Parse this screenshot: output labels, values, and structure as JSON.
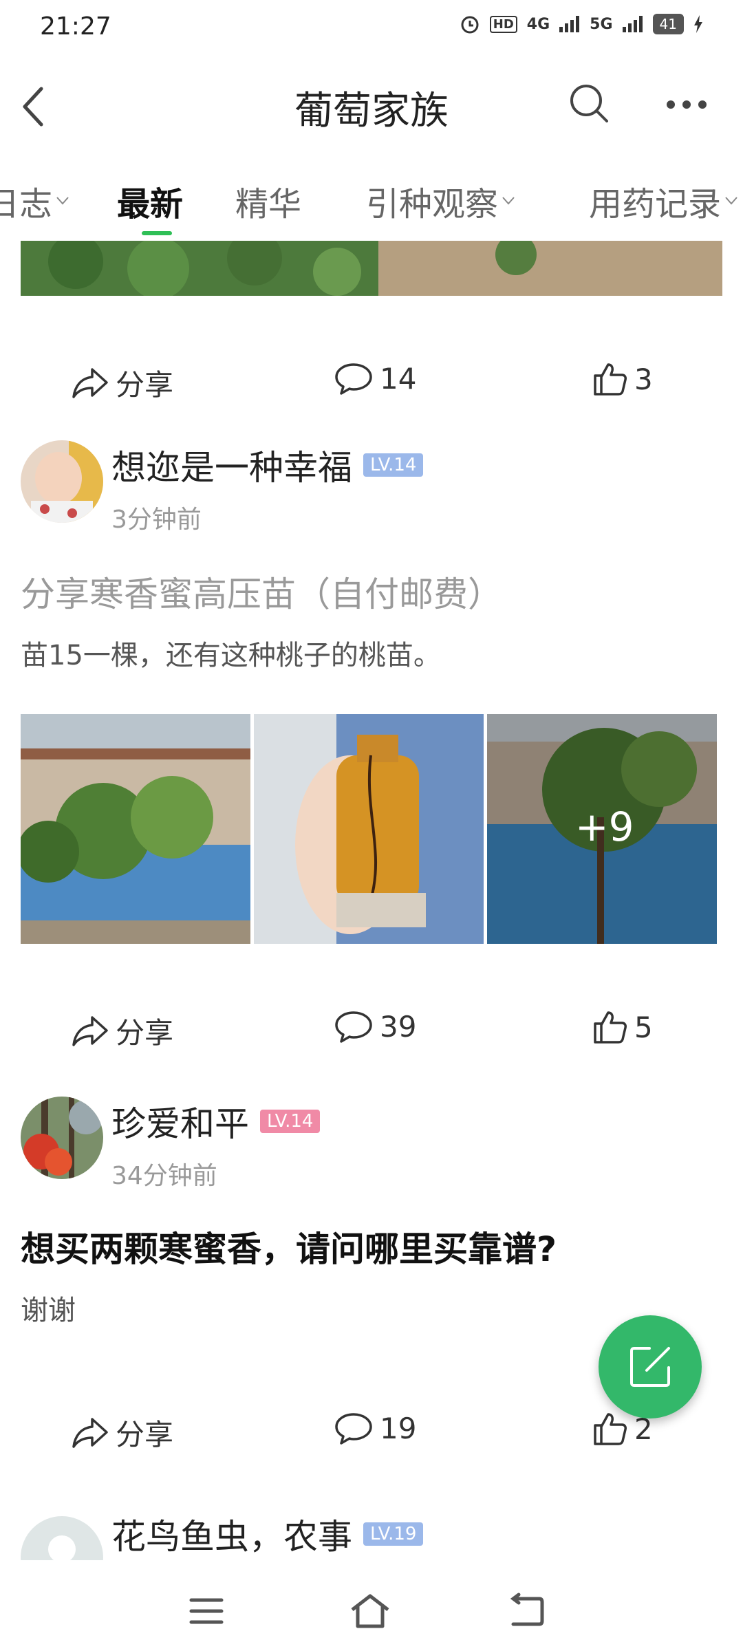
{
  "status_bar": {
    "time": "21:27",
    "network": "4G",
    "network2": "5G",
    "battery": "41",
    "hd": "HD"
  },
  "header": {
    "title": "葡萄家族"
  },
  "tabs": [
    {
      "label": "日志",
      "dropdown": true
    },
    {
      "label": "最新",
      "active": true
    },
    {
      "label": "精华"
    },
    {
      "label": "引种观察",
      "dropdown": true
    },
    {
      "label": "用药记录",
      "dropdown": true
    }
  ],
  "colors": {
    "accent": "#2fbf56",
    "fab": "#33b86a",
    "lv_blue": "#9bb8ea",
    "lv_pink": "#f08aa6"
  },
  "post0": {
    "share": "分享",
    "comments": "14",
    "likes": "3"
  },
  "post1": {
    "author": "想迩是一种幸福",
    "level": "LV.14",
    "time": "3分钟前",
    "title": "分享寒香蜜高压苗（自付邮费）",
    "body": "苗15一棵，还有这种桃子的桃苗。",
    "more_images": "+9",
    "share": "分享",
    "comments": "39",
    "likes": "5"
  },
  "post2": {
    "author": "珍爱和平",
    "level": "LV.14",
    "time": "34分钟前",
    "title": "想买两颗寒蜜香，请问哪里买靠谱?",
    "body": "谢谢",
    "share": "分享",
    "comments": "19",
    "likes": "2"
  },
  "post3": {
    "author": "花鸟鱼虫，农事",
    "level": "LV.19"
  },
  "icons": [
    "back-icon",
    "search-icon",
    "more-icon",
    "share-icon",
    "comment-icon",
    "like-icon",
    "edit-icon",
    "menu-icon",
    "home-icon",
    "return-icon"
  ]
}
